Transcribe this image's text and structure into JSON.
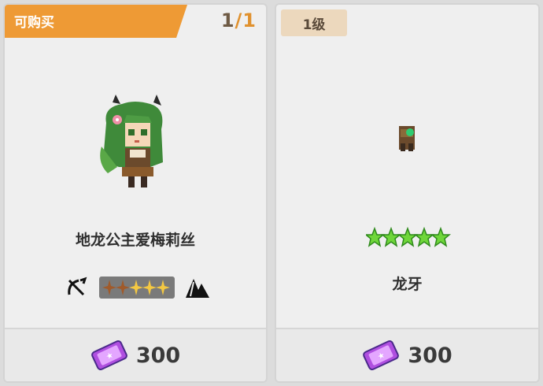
{
  "cards": [
    {
      "badge_label": "可购买",
      "stock": {
        "current": "1",
        "separator": "/",
        "max": "1"
      },
      "name": "地龙公主爱梅莉丝",
      "class_icon": "bow-crossed-icon",
      "terrain_icon": "mountain-icon",
      "rarity_stars": 5,
      "rarity_filled": 3,
      "currency_icon": "ticket-icon",
      "price": "300"
    },
    {
      "level_label": "1级",
      "name": "龙牙",
      "stars": 5,
      "star_color": "#6fd63a",
      "currency_icon": "ticket-icon",
      "price": "300"
    }
  ],
  "colors": {
    "badge_orange": "#ee9a35",
    "level_bg": "#ecd8bd",
    "gold_star": "#f4c842",
    "green_star": "#6fd63a"
  }
}
